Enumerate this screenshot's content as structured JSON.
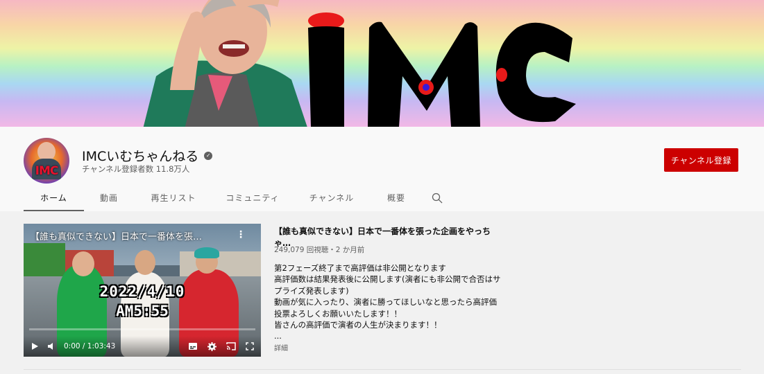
{
  "banner": {
    "logo_text": "IMC"
  },
  "channel": {
    "name": "IMCいむちゃんねる",
    "subscribers": "チャンネル登録者数 11.8万人",
    "avatar_text": "IMC",
    "subscribe_label": "チャンネル登録"
  },
  "tabs": [
    "ホーム",
    "動画",
    "再生リスト",
    "コミュニティ",
    "チャンネル",
    "概要"
  ],
  "featured": {
    "player_title": "【誰も真似できない】日本で一番体を張…",
    "overlay_date": "2022/4/10",
    "overlay_time": "AM5:55",
    "time_display": "0:00 / 1:03:43",
    "progress": 0,
    "title": "【誰も真似できない】日本で一番体を張った企画をやっちゃ…",
    "meta": "249,079 回視聴・2 か月前",
    "description": [
      "第2フェーズ終了まで高評価は非公開となります",
      "高評価数は結果発表後に公開します(演者にも非公開で合否はサ",
      "プライズ発表します)",
      "動画が気に入ったり、演者に勝ってほしいなと思ったら高評価",
      "投票よろしくお願いいたします！！",
      "皆さんの高評価で演者の人生が決まります！！",
      "..."
    ],
    "more_label": "詳細"
  },
  "colors": {
    "subscribe": "#cc0000",
    "page_bg": "#f9f9f9",
    "content_bg": "#f1f1f1"
  },
  "icons": [
    "verified-badge-icon",
    "search-icon",
    "kebab-menu-icon",
    "play-icon",
    "volume-icon",
    "subtitles-icon",
    "settings-icon",
    "cast-icon",
    "fullscreen-icon"
  ]
}
